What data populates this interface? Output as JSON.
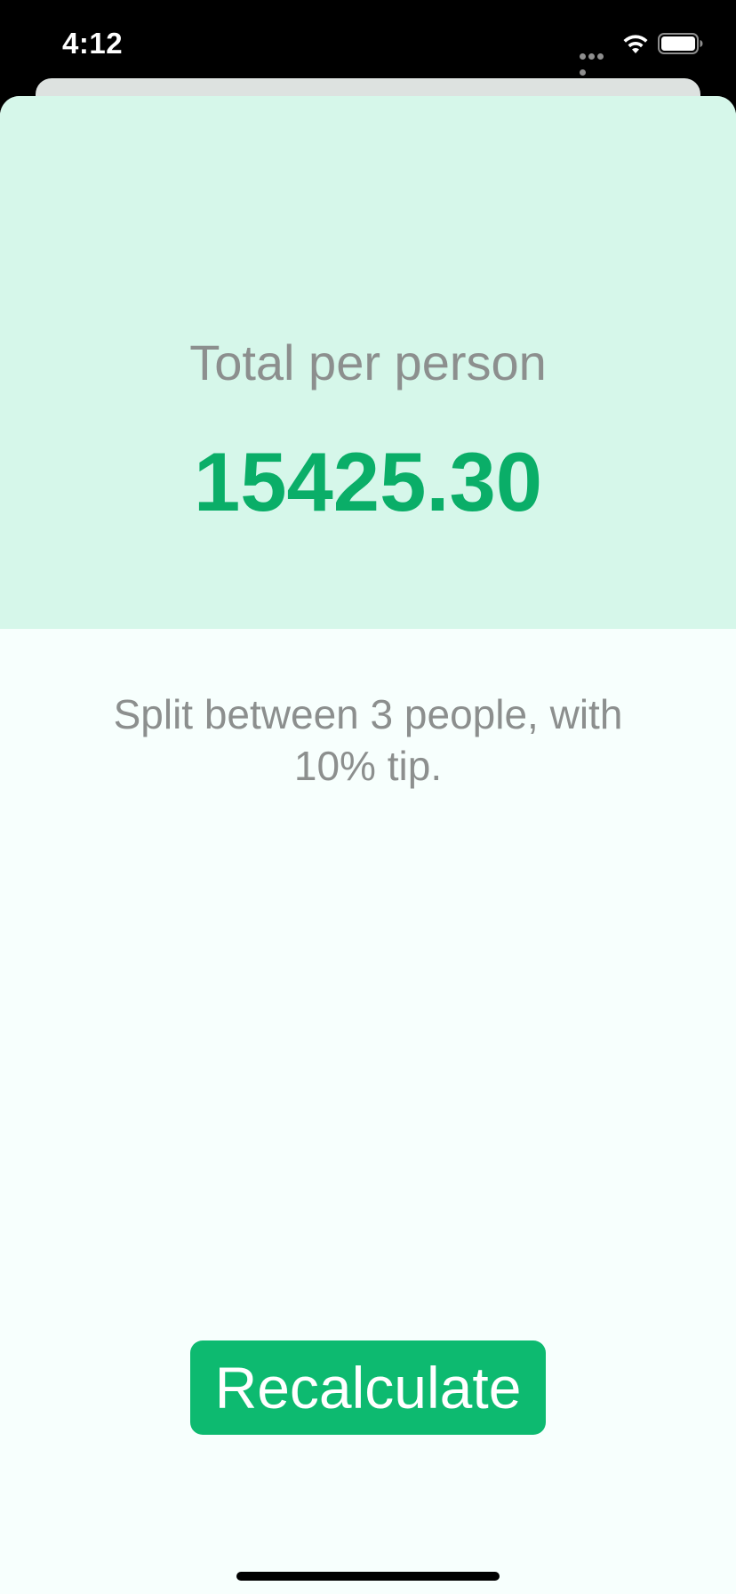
{
  "status_bar": {
    "time": "4:12"
  },
  "result": {
    "label": "Total per person",
    "value": "15425.30"
  },
  "details": {
    "text": "Split between 3 people, with 10% tip."
  },
  "actions": {
    "recalculate_label": "Recalculate"
  },
  "colors": {
    "accent": "#0DBA70",
    "result_panel_bg": "#D6F7EA",
    "background": "#F7FFFD",
    "secondary_text": "#8C8F8E"
  },
  "icons": {
    "signal": "cellular-signal-icon",
    "wifi": "wifi-icon",
    "battery": "battery-icon"
  }
}
